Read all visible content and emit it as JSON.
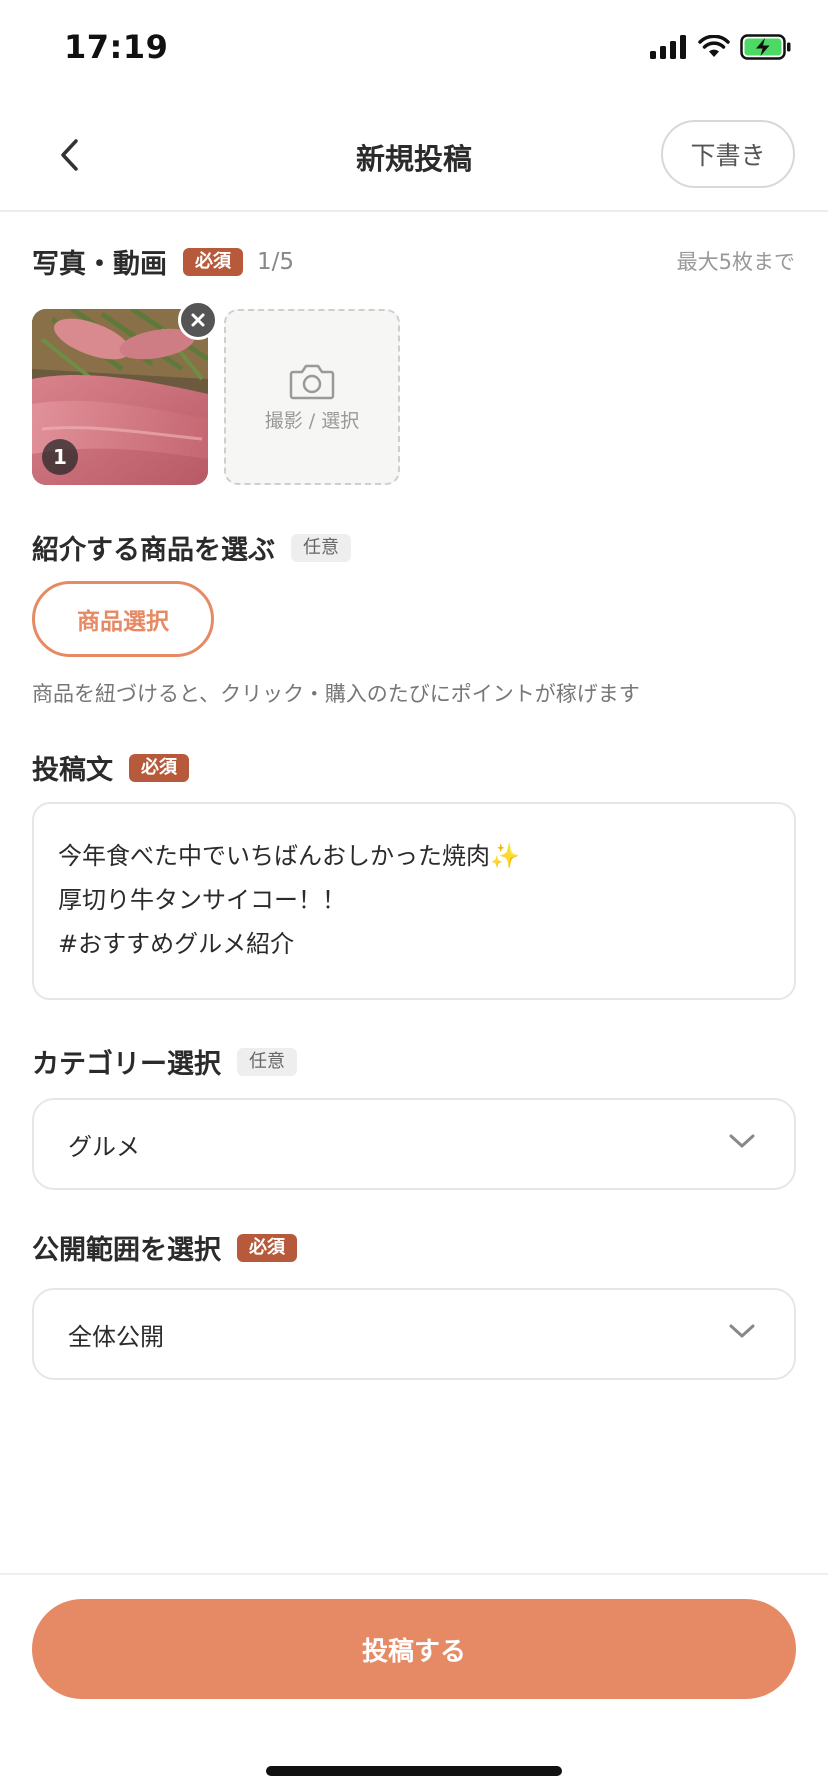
{
  "status": {
    "time": "17:19"
  },
  "nav": {
    "title": "新規投稿",
    "draft_label": "下書き"
  },
  "photos": {
    "label": "写真・動画",
    "badge": "必須",
    "count": "1/5",
    "max_note": "最大5枚まで",
    "items": [
      {
        "number": "1"
      }
    ],
    "add_label": "撮影 / 選択"
  },
  "product": {
    "label": "紹介する商品を選ぶ",
    "badge": "任意",
    "button_label": "商品選択",
    "helper": "商品を紐づけると、クリック・購入のたびにポイントが稼げます"
  },
  "post_text": {
    "label": "投稿文",
    "badge": "必須",
    "lines": [
      "今年食べた中でいちばんおしかった焼肉✨",
      "厚切り牛タンサイコー！！",
      "#おすすめグルメ紹介"
    ]
  },
  "category": {
    "label": "カテゴリー選択",
    "badge": "任意",
    "value": "グルメ"
  },
  "visibility": {
    "label": "公開範囲を選択",
    "badge": "必須",
    "value": "全体公開"
  },
  "submit_label": "投稿する",
  "colors": {
    "accent": "#e68a65",
    "required_badge": "#b65a3b"
  },
  "icons": [
    "signal-icon",
    "wifi-icon",
    "battery-charging-icon",
    "back-chevron-icon",
    "close-icon",
    "camera-icon",
    "chevron-down-icon"
  ]
}
